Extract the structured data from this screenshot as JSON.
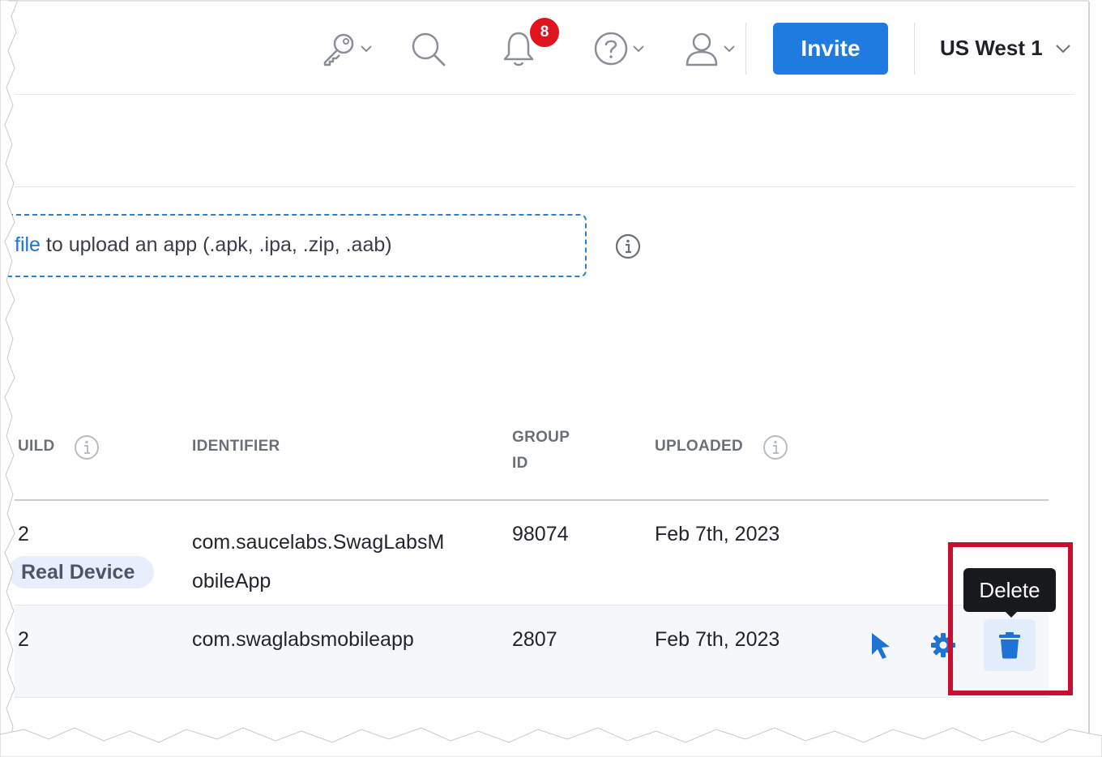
{
  "header": {
    "notifications_count": "8",
    "invite_label": "Invite",
    "region_label": "US West 1"
  },
  "upload": {
    "link_text": "file",
    "text": " to upload an app (.apk, .ipa, .zip, .aab)"
  },
  "table": {
    "columns": {
      "build": "UILD",
      "identifier": "IDENTIFIER",
      "group_id_line1": "GROUP",
      "group_id_line2": "ID",
      "uploaded": "UPLOADED"
    },
    "rows": [
      {
        "build": "2",
        "tag": "Real Device",
        "identifier_line1": "com.saucelabs.SwagLabsM",
        "identifier_line2": "obileApp",
        "group_id": "98074",
        "uploaded": "Feb 7th, 2023"
      },
      {
        "build": "2",
        "identifier": "com.swaglabsmobileapp",
        "group_id": "2807",
        "uploaded": "Feb 7th, 2023"
      }
    ]
  },
  "tooltip": {
    "label": "Delete"
  },
  "colors": {
    "accent": "#1f7be0",
    "badge": "#e0141e",
    "highlight": "#c8102e",
    "tooltip_bg": "#17191d"
  },
  "icons": [
    "key-icon",
    "search-icon",
    "bell-icon",
    "help-icon",
    "user-icon",
    "chevron-down-icon",
    "info-icon",
    "launch-cursor-icon",
    "gear-icon",
    "trash-icon"
  ]
}
